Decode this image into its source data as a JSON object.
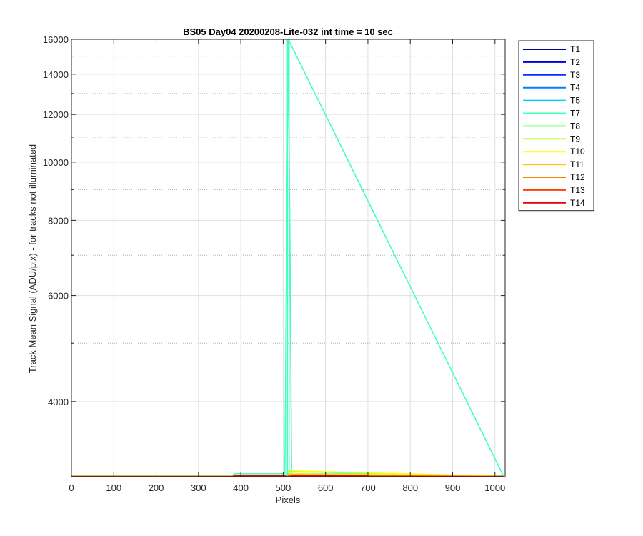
{
  "chart_data": {
    "type": "line",
    "title": "BS05 Day04 20200208-Lite-032 int time = 10 sec",
    "xlabel": "Pixels",
    "ylabel": "Track Mean Signal (ADU/pix) - for tracks not illuminated",
    "xlim": [
      0,
      1024
    ],
    "ylim": [
      3000,
      16000
    ],
    "yscale": "log",
    "xticks": [
      0,
      100,
      200,
      300,
      400,
      500,
      600,
      700,
      800,
      900,
      1000
    ],
    "yticks": [
      4000,
      6000,
      8000,
      10000,
      12000,
      14000,
      16000
    ],
    "yminor_ticks": [
      3000,
      5000,
      7000,
      9000,
      11000,
      13000,
      15000
    ],
    "grid": true,
    "legend_position": "outside-top-right",
    "series": [
      {
        "name": "T1",
        "color": "#00008f",
        "baseline": 3005,
        "spike": 3005
      },
      {
        "name": "T2",
        "color": "#0000df",
        "baseline": 3005,
        "spike": 3005
      },
      {
        "name": "T3",
        "color": "#0030ff",
        "baseline": 3005,
        "spike": 3005
      },
      {
        "name": "T4",
        "color": "#0080ff",
        "baseline": 3010,
        "spike": 3010
      },
      {
        "name": "T5",
        "color": "#00cfff",
        "baseline": 3010,
        "spike": 3010
      },
      {
        "name": "T7",
        "color": "#40ffbf",
        "baseline": 3010,
        "spike": 16000
      },
      {
        "name": "T8",
        "color": "#80ff80",
        "baseline": 3008,
        "spike": 3060
      },
      {
        "name": "T9",
        "color": "#bfff40",
        "baseline": 3006,
        "spike": 3040
      },
      {
        "name": "T10",
        "color": "#ffff00",
        "baseline": 3005,
        "spike": 3070
      },
      {
        "name": "T11",
        "color": "#ffbf00",
        "baseline": 3004,
        "spike": 3030
      },
      {
        "name": "T12",
        "color": "#ff8000",
        "baseline": 3004,
        "spike": 3020
      },
      {
        "name": "T13",
        "color": "#ff4000",
        "baseline": 3003,
        "spike": 3010
      },
      {
        "name": "T14",
        "color": "#df0000",
        "baseline": 3002,
        "spike": 3005
      }
    ],
    "spike_x": 512
  }
}
